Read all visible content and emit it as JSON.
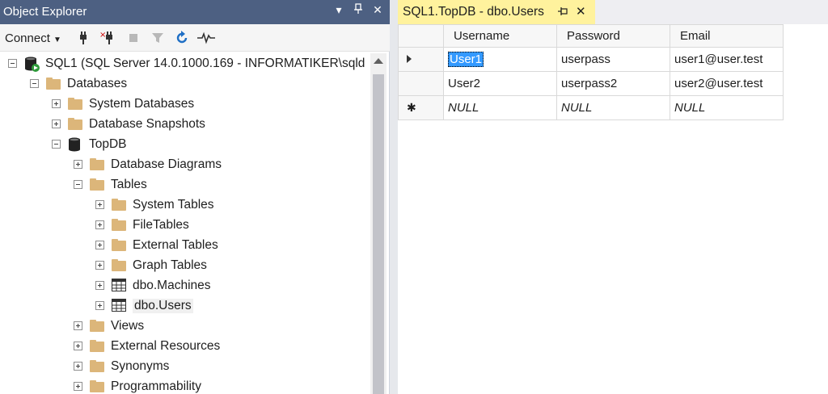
{
  "object_explorer": {
    "title": "Object Explorer",
    "title_buttons": [
      "▾",
      "ᐅ",
      "✕"
    ],
    "connect_label": "Connect",
    "toolbar_icons": [
      "connect-plug-icon",
      "disconnect-icon",
      "stop-icon",
      "filter-icon",
      "refresh-icon",
      "activity-monitor-icon"
    ]
  },
  "tree": [
    {
      "label": "SQL1 (SQL Server 14.0.1000.169 - INFORMATIKER\\sqld",
      "icon": "server-icon",
      "expanded": true,
      "level": 0
    },
    {
      "label": "Databases",
      "icon": "folder-icon",
      "expanded": true,
      "level": 1
    },
    {
      "label": "System Databases",
      "icon": "folder-icon",
      "expanded": false,
      "level": 2
    },
    {
      "label": "Database Snapshots",
      "icon": "folder-icon",
      "expanded": false,
      "level": 2
    },
    {
      "label": "TopDB",
      "icon": "database-icon",
      "expanded": true,
      "level": 2
    },
    {
      "label": "Database Diagrams",
      "icon": "folder-icon",
      "expanded": false,
      "level": 3
    },
    {
      "label": "Tables",
      "icon": "folder-icon",
      "expanded": true,
      "level": 3
    },
    {
      "label": "System Tables",
      "icon": "folder-icon",
      "expanded": false,
      "level": 4
    },
    {
      "label": "FileTables",
      "icon": "folder-icon",
      "expanded": false,
      "level": 4
    },
    {
      "label": "External Tables",
      "icon": "folder-icon",
      "expanded": false,
      "level": 4
    },
    {
      "label": "Graph Tables",
      "icon": "folder-icon",
      "expanded": false,
      "level": 4
    },
    {
      "label": "dbo.Machines",
      "icon": "table-icon",
      "expanded": false,
      "level": 4
    },
    {
      "label": "dbo.Users",
      "icon": "table-icon",
      "expanded": false,
      "level": 4,
      "selected": true
    },
    {
      "label": "Views",
      "icon": "folder-icon",
      "expanded": false,
      "level": 3
    },
    {
      "label": "External Resources",
      "icon": "folder-icon",
      "expanded": false,
      "level": 3
    },
    {
      "label": "Synonyms",
      "icon": "folder-icon",
      "expanded": false,
      "level": 3
    },
    {
      "label": "Programmability",
      "icon": "folder-icon",
      "expanded": false,
      "level": 3
    }
  ],
  "document_tab": {
    "title": "SQL1.TopDB - dbo.Users",
    "pin": "⊣",
    "close": "✕"
  },
  "grid": {
    "columns": [
      "Username",
      "Password",
      "Email"
    ],
    "rows": [
      {
        "marker": "current",
        "cells": [
          "User1",
          "userpass",
          "user1@user.test"
        ],
        "selected_cell": 0
      },
      {
        "marker": "none",
        "cells": [
          "User2",
          "userpass2",
          "user2@user.test"
        ]
      },
      {
        "marker": "new",
        "cells": [
          "NULL",
          "NULL",
          "NULL"
        ]
      }
    ]
  },
  "colors": {
    "title_bar": "#4d6082",
    "tab_active": "#fff29d",
    "selection": "#3399ff",
    "folder": "#dcb67a"
  }
}
